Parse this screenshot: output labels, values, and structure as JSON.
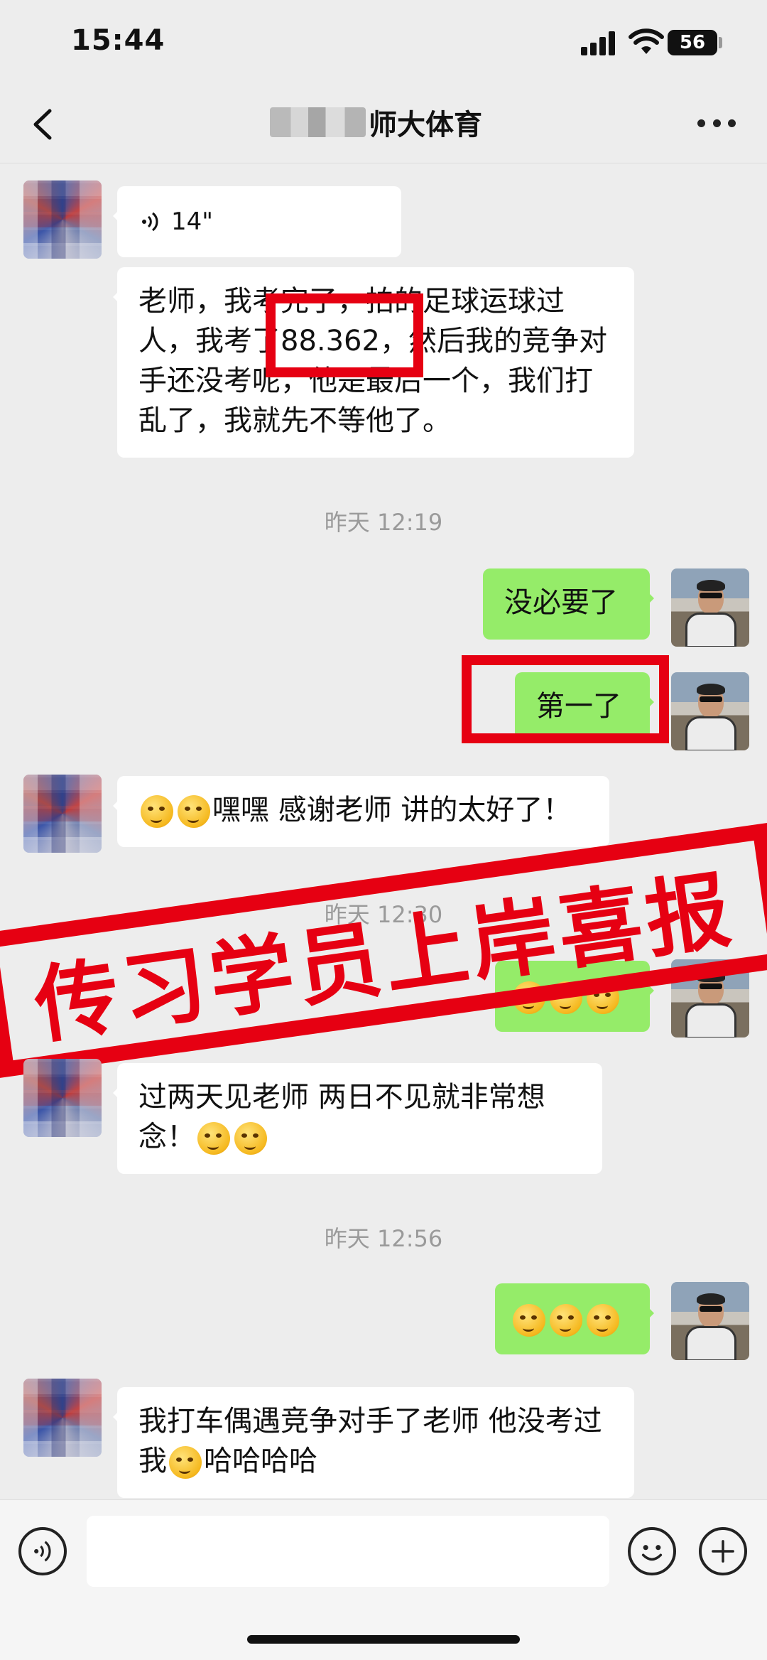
{
  "status_bar": {
    "time": "15:44",
    "battery": "56"
  },
  "nav": {
    "title": "师大体育"
  },
  "messages": {
    "m1_voice_duration": "14\"",
    "m2_text": "老师，我考完了，拍的足球运球过人，我考了88.362，然后我的竞争对手还没考呢，他是最后一个，我们打乱了，我就先不等他了。",
    "ts1": "昨天 12:19",
    "m3_text": "没必要了",
    "m4_text": "第一了",
    "m5_text": "嘿嘿 感谢老师 讲的太好了！",
    "ts2": "昨天 12:30",
    "m7_text_before": "过两天见老师 两日不见就非常想念！",
    "ts3": "昨天 12:56",
    "m9_text_before": "我打车偶遇竞争对手了老师 他没考过我",
    "m9_text_after": "哈哈哈哈"
  },
  "banner": {
    "text": "传习学员上岸喜报"
  },
  "colors": {
    "accent_red": "#e60012",
    "bubble_green": "#95ec69",
    "background": "#ededed"
  },
  "icons": [
    "back-icon",
    "more-icon",
    "voice-icon",
    "emoji-icon",
    "plus-icon",
    "keyboard-voice-icon"
  ]
}
